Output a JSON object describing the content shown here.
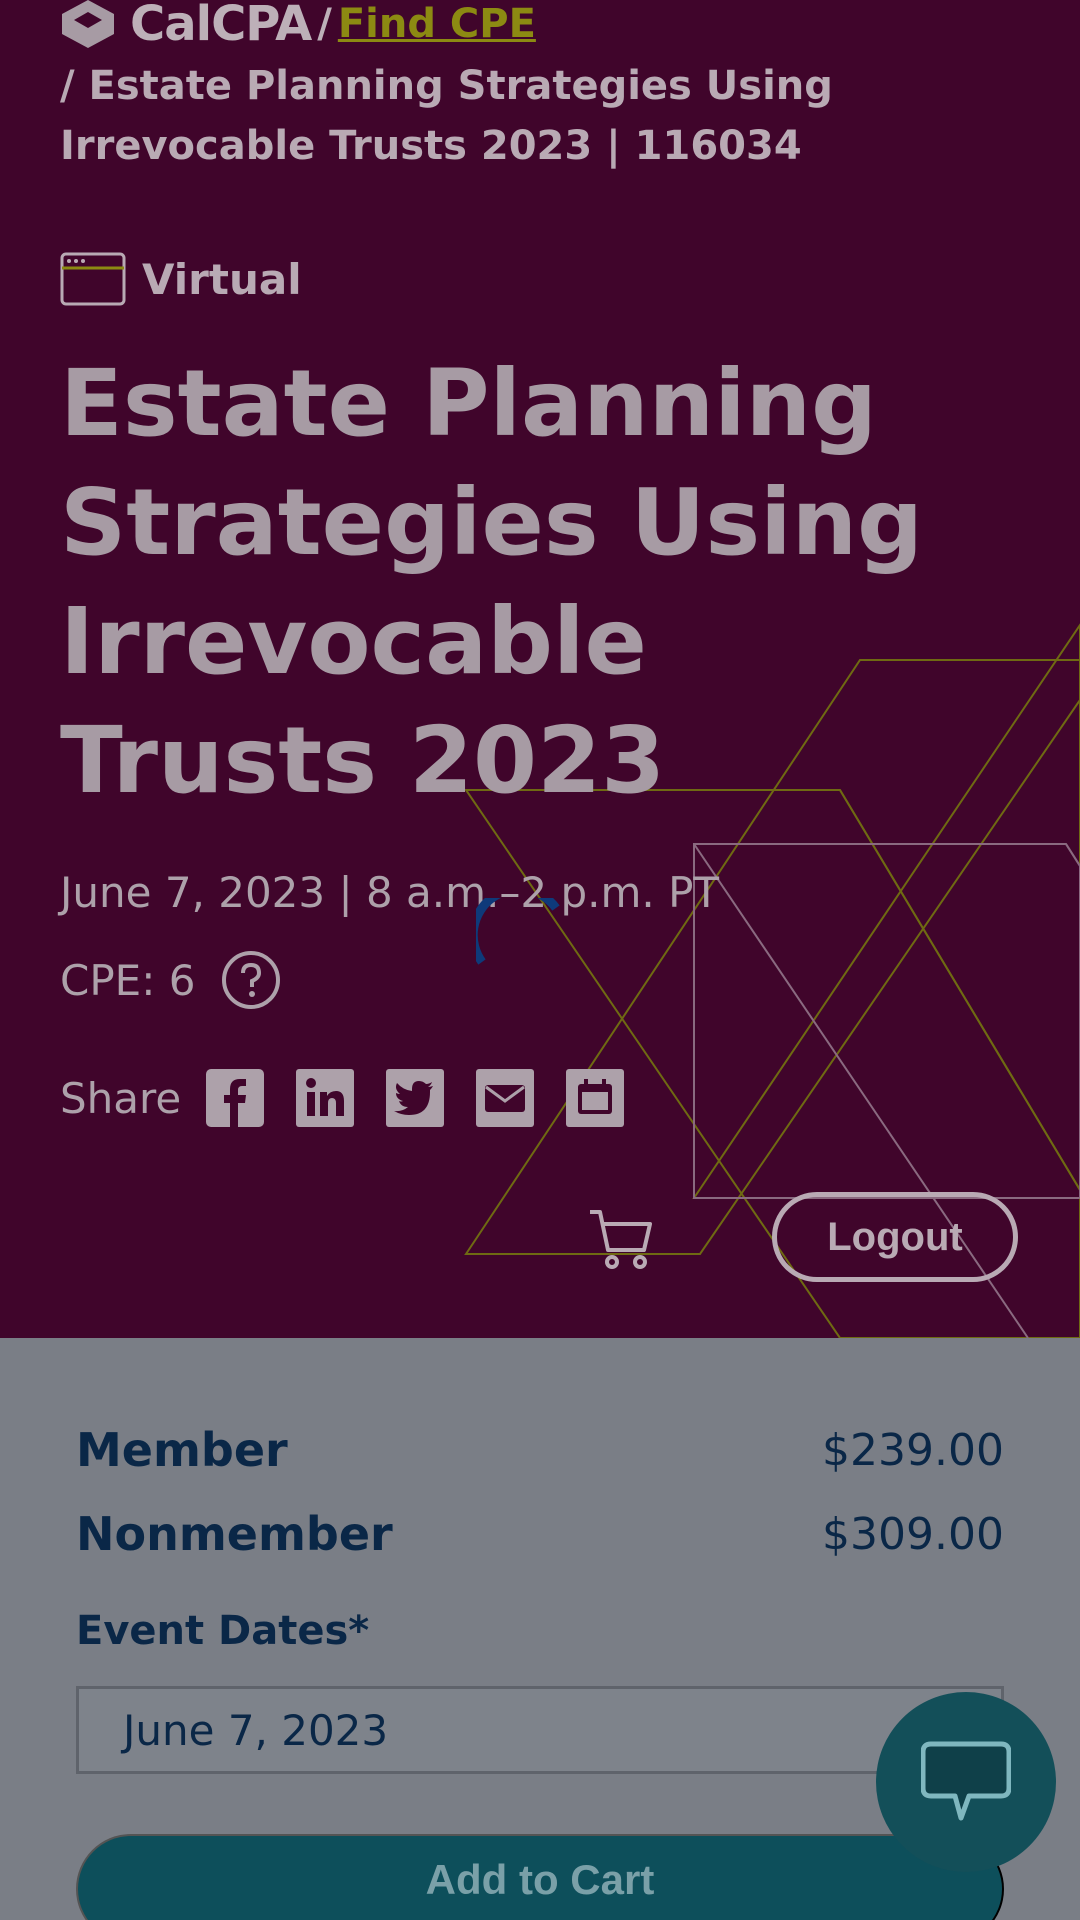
{
  "header": {
    "brand": "CalCPA",
    "separator": "/",
    "find_cpe_link": "Find CPE",
    "breadcrumb_rest": "/ Estate Planning Strategies Using Irrevocable Trusts 2023 | 116034"
  },
  "event": {
    "format_icon": "browser-window-icon",
    "format": "Virtual",
    "title": "Estate Planning Strategies Using Irrevocable Trusts 2023",
    "date_time": "June 7, 2023 | 8 a.m.–2 p.m. PT",
    "cpe": "CPE: 6"
  },
  "share": {
    "label": "Share",
    "icons": [
      "facebook-icon",
      "linkedin-icon",
      "twitter-icon",
      "email-icon",
      "calendar-icon"
    ]
  },
  "account": {
    "cart_icon": "cart-icon",
    "logout_label": "Logout"
  },
  "pricing": {
    "member_label": "Member",
    "member_price": "$239.00",
    "nonmember_label": "Nonmember",
    "nonmember_price": "$309.00"
  },
  "registration": {
    "event_dates_label": "Event Dates*",
    "selected_date": "June 7, 2023",
    "add_to_cart_label": "Add to Cart"
  },
  "chat": {
    "icon": "chat-bubble-icon"
  },
  "colors": {
    "hero_bg": "#40052b",
    "accent_olive": "#8c8a12",
    "navy_text": "#0a2747",
    "teal_button": "#0d4f5b",
    "page_overlay": "#7a7e86"
  }
}
